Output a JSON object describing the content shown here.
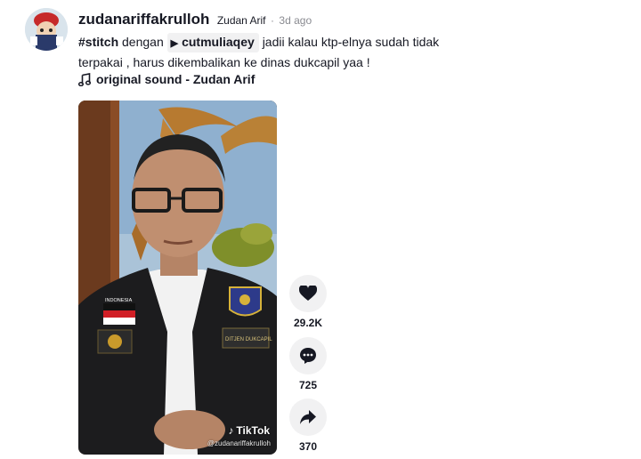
{
  "post": {
    "username": "zudanariffakrulloh",
    "nickname": "Zudan Arif",
    "separator": "·",
    "time": "3d ago"
  },
  "caption": {
    "hashtag": "#stitch",
    "connector": "dengan",
    "stitched_user": "cutmuliaqey",
    "text_line1": "jadii kalau ktp-elnya sudah tidak",
    "text_line2": "terpakai , harus dikembalikan ke dinas dukcapil yaa !"
  },
  "sound": {
    "label": "original sound - Zudan Arif",
    "icon": "music-note-icon"
  },
  "video": {
    "badge_country": "INDONESIA",
    "vest_tag": "DITJEN DUKCAPIL",
    "watermark_brand": "TikTok",
    "watermark_user": "@zudanariffakrulloh"
  },
  "actions": {
    "likes": "29.2K",
    "comments": "725",
    "shares": "370"
  },
  "colors": {
    "text": "#161823",
    "muted": "#8a8b91",
    "chip_bg": "#f1f1f2",
    "button_bg": "#f1f1f2"
  }
}
